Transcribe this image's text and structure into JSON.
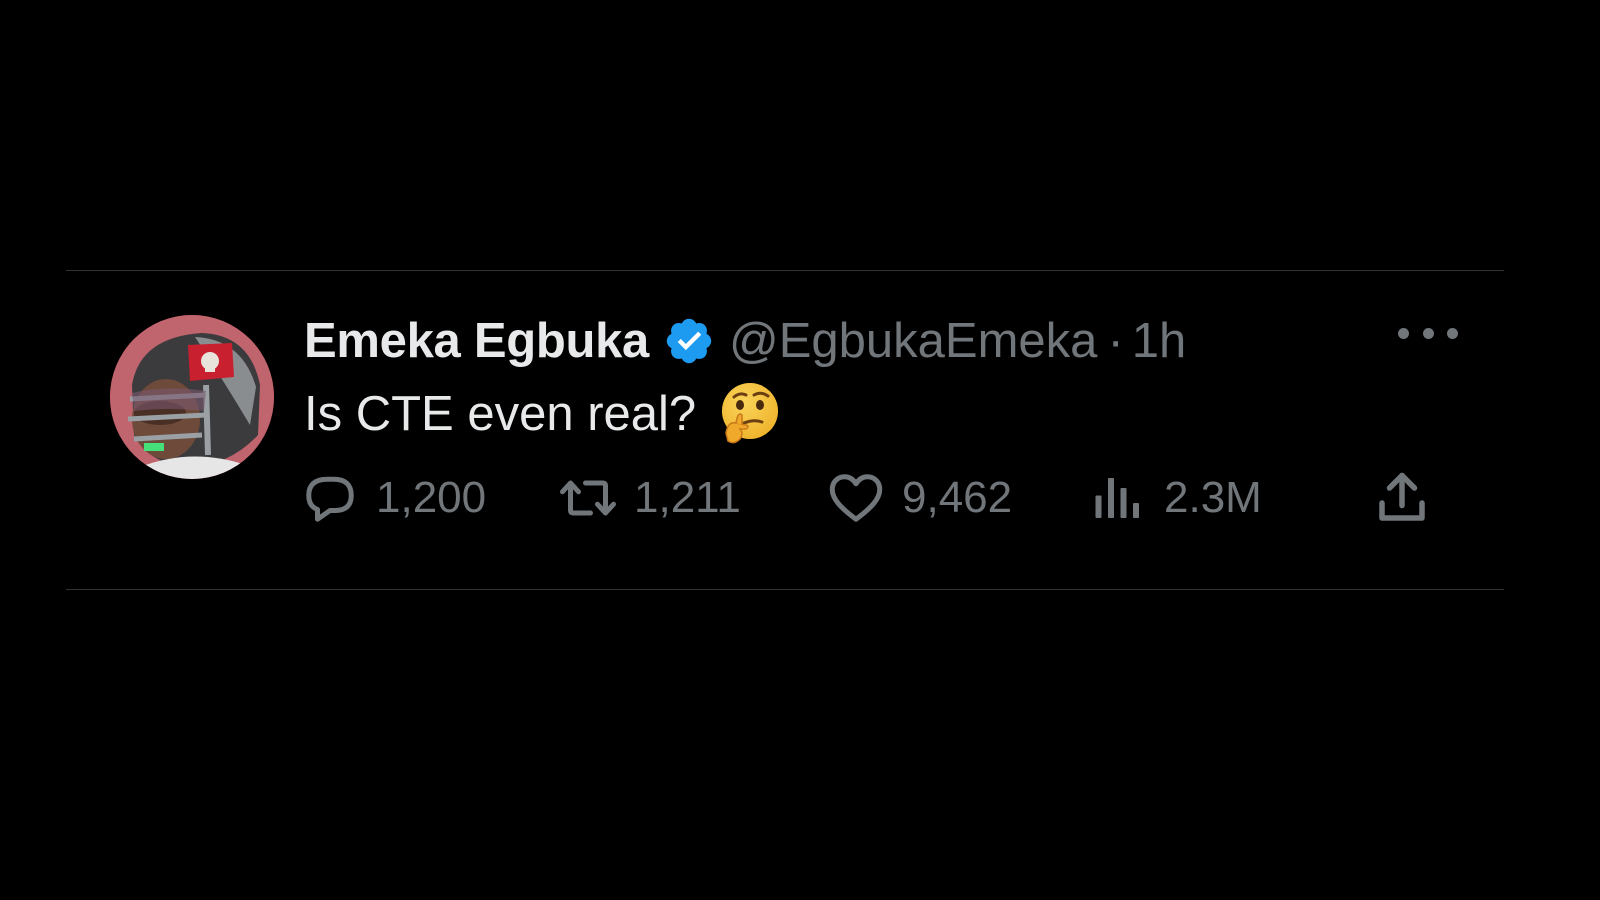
{
  "tweet": {
    "display_name": "Emeka Egbuka",
    "handle": "@EgbukaEmeka",
    "separator": "·",
    "time": "1h",
    "text": "Is CTE even real?",
    "emoji": "thinking-face",
    "verified": true
  },
  "actions": {
    "replies": "1,200",
    "retweets": "1,211",
    "likes": "9,462",
    "views": "2.3M"
  },
  "colors": {
    "background": "#000000",
    "primary_text": "#e7e9ea",
    "secondary_text": "#71767b",
    "verified_blue": "#1d9bf0",
    "divider": "#2f3336"
  },
  "icons": {
    "reply": "reply-icon",
    "retweet": "retweet-icon",
    "like": "heart-icon",
    "views": "views-icon",
    "share": "share-icon",
    "more": "more-icon",
    "verified": "verified-badge-icon"
  }
}
